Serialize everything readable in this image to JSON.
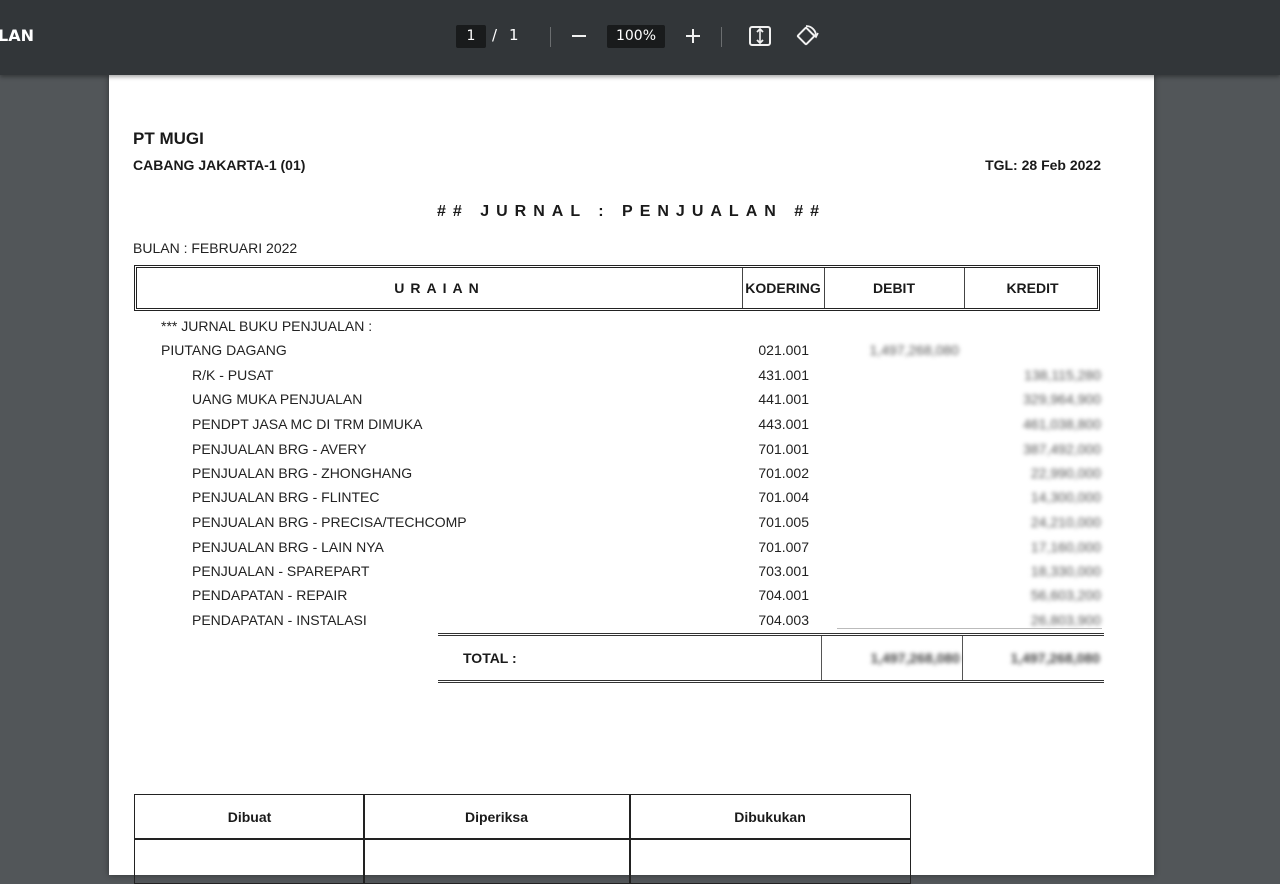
{
  "toolbar": {
    "doc_title": "LAN",
    "page_current": "1",
    "page_separator": "/",
    "page_total": "1",
    "zoom": "100%",
    "zoom_out_icon": "minus-icon",
    "zoom_in_icon": "plus-icon",
    "fit_icon": "fit-to-page-icon",
    "rotate_icon": "rotate-icon"
  },
  "doc": {
    "company": "PT MUGI",
    "branch": "CABANG JAKARTA-1 (01)",
    "date": "TGL: 28 Feb 2022",
    "title": "## JURNAL : PENJUALAN ##",
    "month": "BULAN : FEBRUARI 2022",
    "headers": {
      "uraian": "URAIAN",
      "kodering": "KODERING",
      "debit": "DEBIT",
      "kredit": "KREDIT"
    },
    "rows": [
      {
        "desc": "*** JURNAL BUKU PENJUALAN :",
        "kode": "",
        "debit": "",
        "kredit": ""
      },
      {
        "desc": "PIUTANG DAGANG",
        "kode": "021.001",
        "debit": "1,497,268,080",
        "kredit": ""
      },
      {
        "desc": "R/K - PUSAT",
        "kode": "431.001",
        "debit": "",
        "kredit": "138,115,280"
      },
      {
        "desc": "UANG MUKA PENJUALAN",
        "kode": "441.001",
        "debit": "",
        "kredit": "329,964,900"
      },
      {
        "desc": "PENDPT JASA MC DI TRM DIMUKA",
        "kode": "443.001",
        "debit": "",
        "kredit": "461,038,800"
      },
      {
        "desc": "PENJUALAN BRG - AVERY",
        "kode": "701.001",
        "debit": "",
        "kredit": "387,492,000"
      },
      {
        "desc": "PENJUALAN BRG - ZHONGHANG",
        "kode": "701.002",
        "debit": "",
        "kredit": "22,990,000"
      },
      {
        "desc": "PENJUALAN BRG - FLINTEC",
        "kode": "701.004",
        "debit": "",
        "kredit": "14,300,000"
      },
      {
        "desc": "PENJUALAN BRG - PRECISA/TECHCOMP",
        "kode": "701.005",
        "debit": "",
        "kredit": "24,210,000"
      },
      {
        "desc": "PENJUALAN BRG - LAIN NYA",
        "kode": "701.007",
        "debit": "",
        "kredit": "17,160,000"
      },
      {
        "desc": "PENJUALAN - SPAREPART",
        "kode": "703.001",
        "debit": "",
        "kredit": "18,330,000"
      },
      {
        "desc": "PENDAPATAN - REPAIR",
        "kode": "704.001",
        "debit": "",
        "kredit": "56,603,200"
      },
      {
        "desc": "PENDAPATAN - INSTALASI",
        "kode": "704.003",
        "debit": "",
        "kredit": "26,803,900"
      }
    ],
    "total_label": "TOTAL :",
    "total_debit": "1,497,268,080",
    "total_kredit": "1,497,268,080",
    "sign": {
      "dibuat": "Dibuat",
      "diperiksa": "Diperiksa",
      "dibukukan": "Dibukukan"
    }
  }
}
